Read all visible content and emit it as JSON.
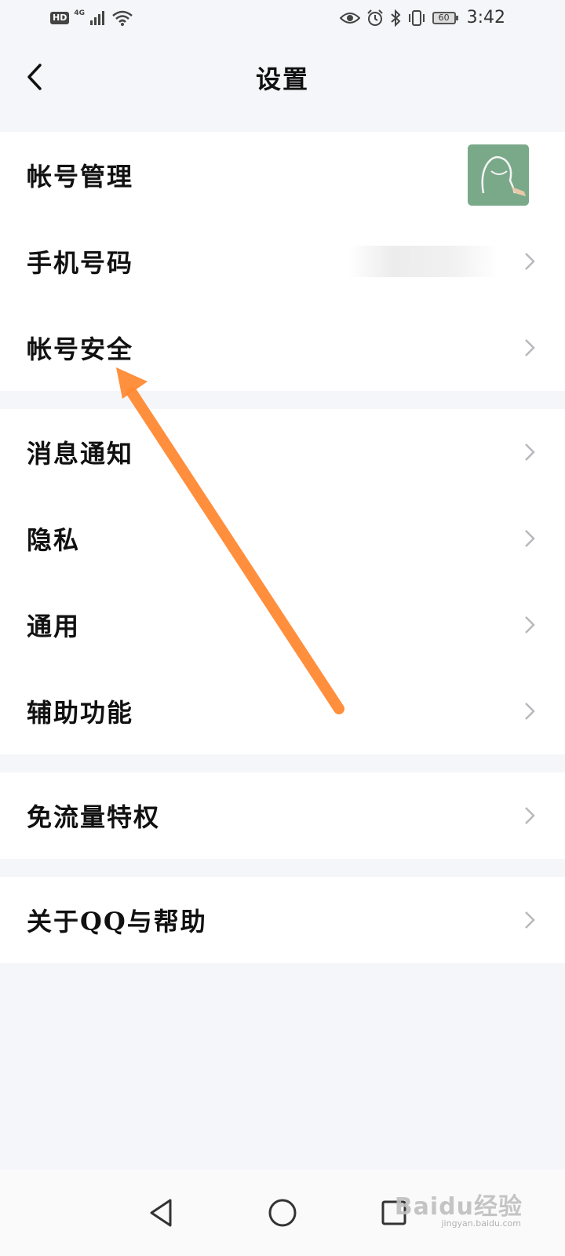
{
  "status_bar": {
    "hd": "HD",
    "network": "4G",
    "battery": "60",
    "time": "3:42"
  },
  "header": {
    "title": "设置"
  },
  "settings": {
    "account_management": "帐号管理",
    "phone_number": "手机号码",
    "account_security": "帐号安全",
    "notifications": "消息通知",
    "privacy": "隐私",
    "general": "通用",
    "accessibility": "辅助功能",
    "free_data": "免流量特权",
    "about_help": "关于QQ与帮助"
  },
  "watermark": {
    "brand": "Baidu经验",
    "url": "jingyan.baidu.com"
  },
  "colors": {
    "background": "#f5f6fa",
    "arrow": "#ff8a33",
    "chevron": "#b8b8bd"
  }
}
